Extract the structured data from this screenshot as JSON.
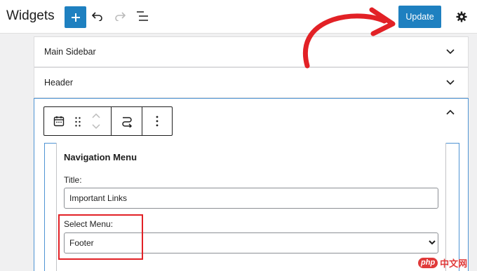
{
  "header": {
    "title": "Widgets",
    "update_label": "Update",
    "icons": [
      "plus-icon",
      "undo-icon",
      "redo-icon",
      "list-view-icon",
      "gear-icon"
    ]
  },
  "panels": [
    {
      "label": "Main Sidebar",
      "expanded": false
    },
    {
      "label": "Header",
      "expanded": false
    },
    {
      "label": "",
      "expanded": true
    }
  ],
  "widget": {
    "title": "Navigation Menu",
    "title_label": "Title:",
    "title_value": "Important Links",
    "menu_label": "Select Menu:",
    "menu_value": "Footer"
  },
  "watermark": {
    "badge": "php",
    "text": "中文网"
  },
  "colors": {
    "accent": "#1e80c0",
    "annotation": "#e22126",
    "focus": "#4f94d4"
  }
}
